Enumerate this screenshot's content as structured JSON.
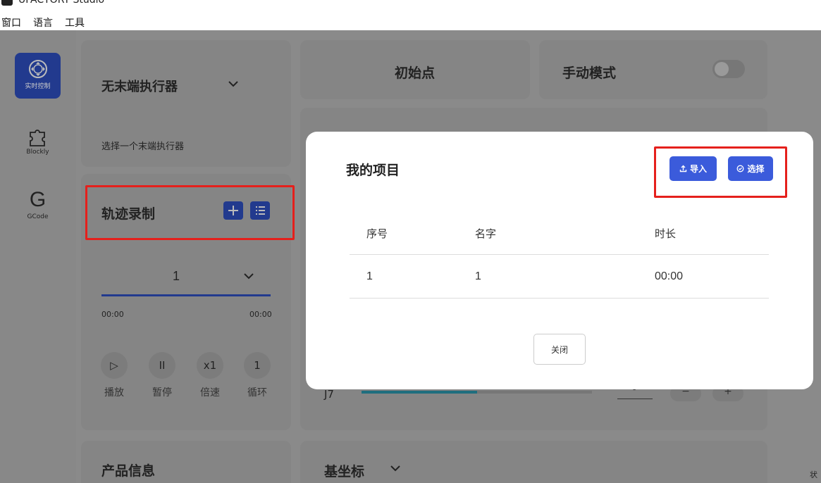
{
  "window": {
    "title": "UFACTORY Studio"
  },
  "menubar": [
    "窗口",
    "语言",
    "工具"
  ],
  "sidebar": {
    "items": [
      {
        "label": "实时控制",
        "icon": "gamepad-icon",
        "active": true
      },
      {
        "label": "Blockly",
        "icon": "puzzle-icon",
        "active": false
      },
      {
        "label": "GCode",
        "icon": "g-letter-icon",
        "active": false
      }
    ]
  },
  "end_effector": {
    "selected": "无末端执行器",
    "hint": "选择一个末端执行器"
  },
  "trajectory": {
    "title": "轨迹录制",
    "selected": "1",
    "time_start": "00:00",
    "time_end": "00:00",
    "controls": [
      {
        "label": "播放",
        "glyph": "▷"
      },
      {
        "label": "暂停",
        "glyph": "II"
      },
      {
        "label": "倍速",
        "glyph": "x1"
      },
      {
        "label": "循环",
        "glyph": "1"
      }
    ]
  },
  "top": {
    "home_label": "初始点",
    "manual_mode_label": "手动模式",
    "manual_mode_on": false
  },
  "joint_row": {
    "label": "J7",
    "value": "0",
    "minus": "−",
    "plus": "+"
  },
  "product_info": {
    "title": "产品信息"
  },
  "coordinate": {
    "title": "基坐标"
  },
  "status_fragment": "状",
  "modal": {
    "title": "我的项目",
    "import_label": "导入",
    "select_label": "选择",
    "columns": [
      "序号",
      "名字",
      "时长"
    ],
    "rows": [
      {
        "index": "1",
        "name": "1",
        "duration": "00:00"
      }
    ],
    "close_label": "关闭"
  },
  "colors": {
    "primary": "#3b5bdb",
    "highlight": "#e5201c",
    "active_nav": "#223a8e"
  }
}
